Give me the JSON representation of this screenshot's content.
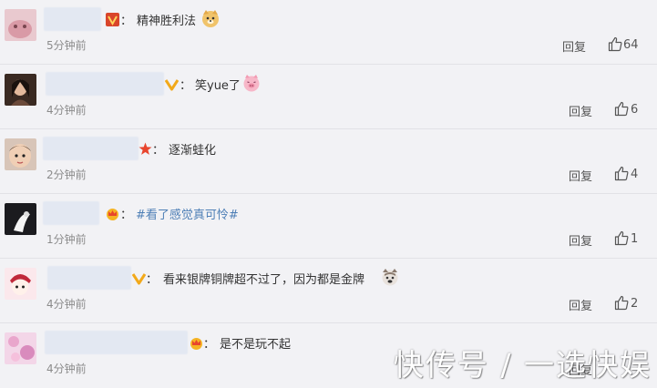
{
  "comments": [
    {
      "text": "精神胜利法",
      "time": "5分钟前",
      "reply": "回复",
      "likes": "64",
      "badge": "gold-v-badge",
      "emoji": "doge-emoji"
    },
    {
      "text": "笑yue了",
      "time": "4分钟前",
      "reply": "回复",
      "likes": "6",
      "badge": "yellow-v-badge",
      "emoji": "pig-emoji"
    },
    {
      "text": "逐渐蛙化",
      "time": "2分钟前",
      "reply": "回复",
      "likes": "4",
      "badge": "red-star-badge"
    },
    {
      "text": "#看了感觉真可怜#",
      "time": "1分钟前",
      "reply": "回复",
      "likes": "1",
      "badge": "crown-badge"
    },
    {
      "text": "看来银牌铜牌超不过了，因为都是金牌",
      "time": "4分钟前",
      "reply": "回复",
      "likes": "2",
      "badge": "yellow-v-badge",
      "emoji": "husky-emoji"
    },
    {
      "text": "是不是玩不起",
      "time": "4分钟前",
      "reply": "回复",
      "likes": "",
      "badge": "crown-badge"
    }
  ],
  "colon": "：",
  "watermark": "快传号 / 一选快娱",
  "colors": {
    "topic": "#4e7fb6",
    "background": "#f2f2f5",
    "time": "#8b8b8b"
  }
}
